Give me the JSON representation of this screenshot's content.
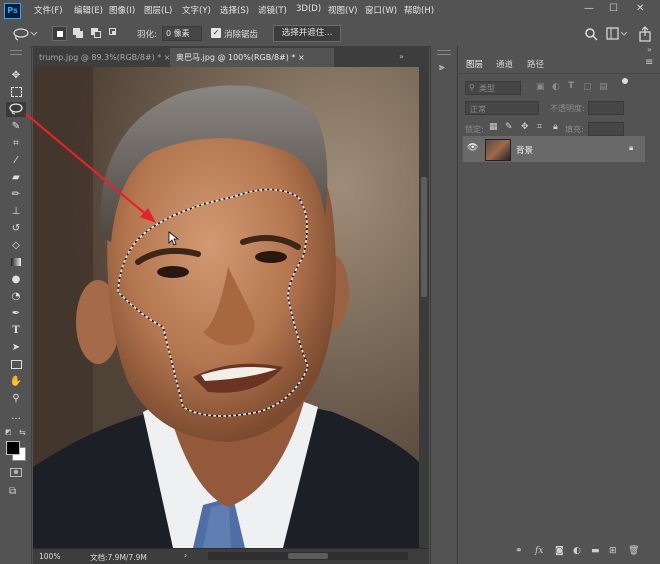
{
  "menu": {
    "logo": "Ps",
    "items": [
      "文件(F)",
      "编辑(E)",
      "图像(I)",
      "图层(L)",
      "文字(Y)",
      "选择(S)",
      "滤镜(T)",
      "3D(D)",
      "视图(V)",
      "窗口(W)",
      "帮助(H)"
    ],
    "window_controls": [
      "—",
      "☐",
      "✕"
    ]
  },
  "options": {
    "feather_label": "羽化:",
    "feather_value": "0 像素",
    "antialias_label": "消除锯齿",
    "select_mask_button": "选择并遮住..."
  },
  "tabs": [
    {
      "label": "trump.jpg @ 89.3%(RGB/8#) *",
      "close": "×",
      "active": false
    },
    {
      "label": "奥巴马.jpg @ 100%(RGB/8#) *",
      "close": "×",
      "active": true
    }
  ],
  "status": {
    "zoom": "100%",
    "doc": "文档:7.9M/7.9M",
    "arrow": "›"
  },
  "panel": {
    "tabs": [
      "图层",
      "通道",
      "路径"
    ],
    "filter_placeholder": "类型",
    "blend_mode": "正常",
    "opacity_label": "不透明度:",
    "lock_label": "锁定:",
    "fill_label": "填充:",
    "layer_name": "背景"
  },
  "tools": [
    "move-tool",
    "marquee-tool",
    "lasso-tool",
    "quick-select-tool",
    "crop-tool",
    "eyedropper-tool",
    "healing-brush-tool",
    "brush-tool",
    "clone-stamp-tool",
    "history-brush-tool",
    "eraser-tool",
    "gradient-tool",
    "blur-tool",
    "dodge-tool",
    "pen-tool",
    "type-tool",
    "path-select-tool",
    "shape-tool",
    "hand-tool",
    "zoom-tool",
    "more-tools"
  ],
  "colors": {
    "accent": "#31a8ff",
    "ui_bg": "#535353",
    "arrow": "#e8202a"
  }
}
